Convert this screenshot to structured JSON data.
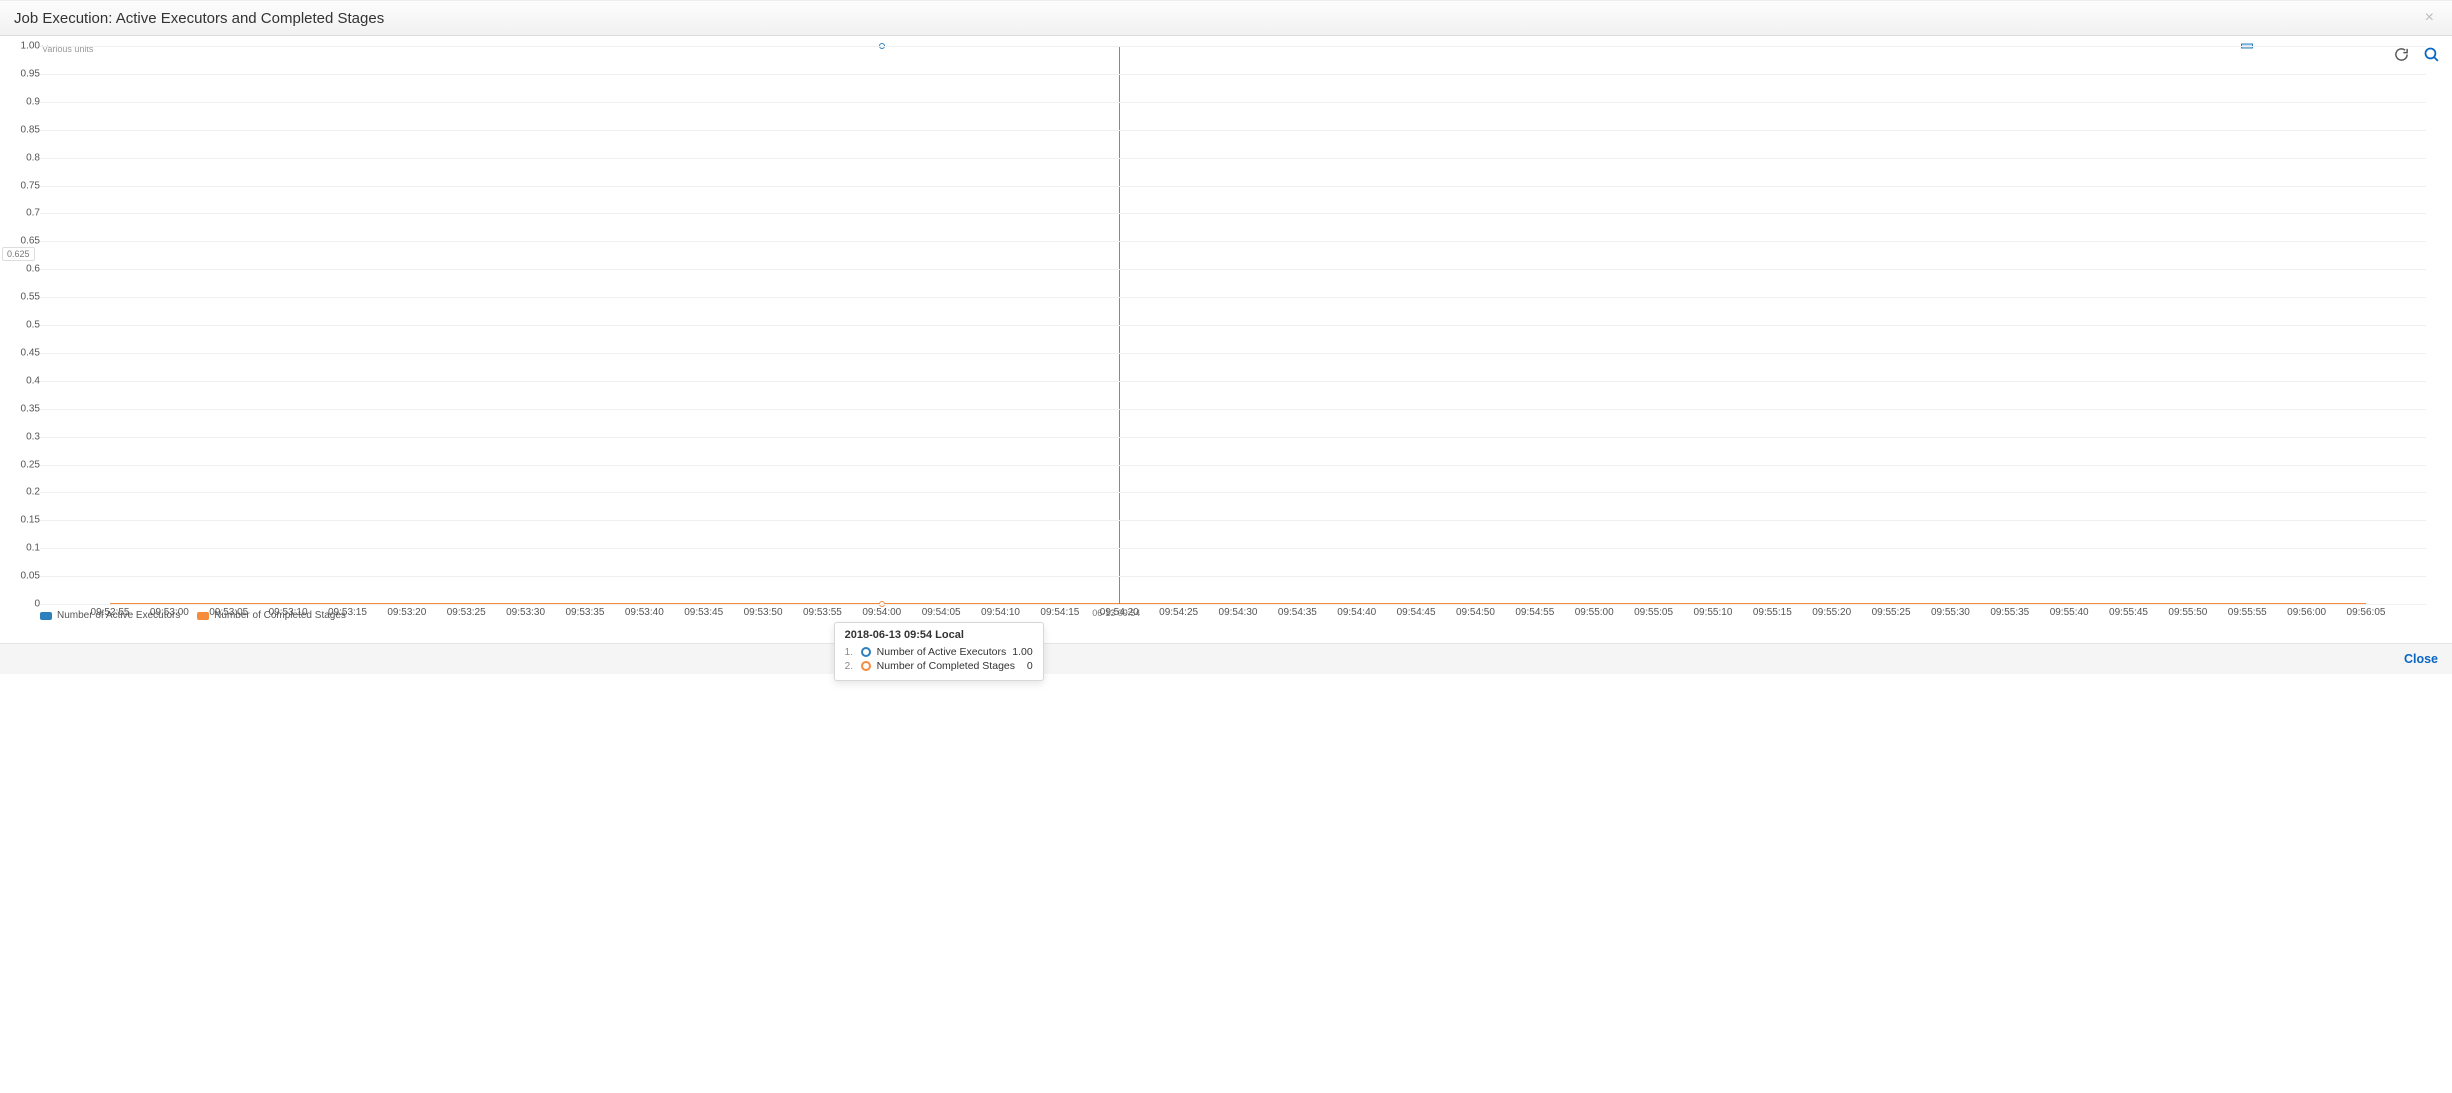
{
  "header": {
    "title": "Job Execution: Active Executors and Completed Stages"
  },
  "toolbar": {
    "refresh_icon_title": "Refresh",
    "zoom_icon_title": "Zoom"
  },
  "chart": {
    "unit_label": "Various units",
    "hover_y_value": "0.625",
    "crosshair_label": "06-13 09:54"
  },
  "legend": {
    "series_a": "Number of Active Executors",
    "series_b": "Number of Completed Stages"
  },
  "tooltip": {
    "title": "2018-06-13 09:54 Local",
    "row1_idx": "1.",
    "row1_label": "Number of Active Executors",
    "row1_value": "1.00",
    "row2_idx": "2.",
    "row2_label": "Number of Completed Stages",
    "row2_value": "0"
  },
  "footer": {
    "close_label": "Close"
  },
  "chart_data": {
    "type": "line",
    "title": "Job Execution: Active Executors and Completed Stages",
    "xlabel": "",
    "ylabel": "Various units",
    "ylim": [
      0,
      1.0
    ],
    "y_ticks": [
      0,
      0.05,
      0.1,
      0.15,
      0.2,
      0.25,
      0.3,
      0.35,
      0.4,
      0.45,
      0.5,
      0.55,
      0.6,
      0.65,
      0.7,
      0.75,
      0.8,
      0.85,
      0.9,
      0.95,
      1.0
    ],
    "x_ticks": [
      "09:52:55",
      "09:53:00",
      "09:53:05",
      "09:53:10",
      "09:53:15",
      "09:53:20",
      "09:53:25",
      "09:53:30",
      "09:53:35",
      "09:53:40",
      "09:53:45",
      "09:53:50",
      "09:53:55",
      "09:54:00",
      "09:54:05",
      "09:54:10",
      "09:54:15",
      "09:54:20",
      "09:54:25",
      "09:54:30",
      "09:54:35",
      "09:54:40",
      "09:54:45",
      "09:54:50",
      "09:54:55",
      "09:55:00",
      "09:55:05",
      "09:55:10",
      "09:55:15",
      "09:55:20",
      "09:55:25",
      "09:55:30",
      "09:55:35",
      "09:55:40",
      "09:55:45",
      "09:55:50",
      "09:55:55",
      "09:56:00",
      "09:56:05"
    ],
    "series": [
      {
        "name": "Number of Active Executors",
        "color": "#2d7fbd",
        "values": [
          1.0,
          1.0,
          1.0,
          1.0,
          1.0,
          1.0,
          1.0,
          1.0,
          1.0,
          1.0,
          1.0,
          1.0,
          1.0,
          1.0,
          1.0,
          1.0,
          1.0,
          1.0,
          1.0,
          1.0,
          1.0,
          1.0,
          1.0,
          1.0,
          1.0,
          1.0,
          1.0,
          1.0,
          1.0,
          1.0,
          1.0,
          1.0,
          1.0,
          1.0,
          1.0,
          1.0,
          1.0,
          1.0,
          1.0
        ]
      },
      {
        "name": "Number of Completed Stages",
        "color": "#f58b3c",
        "values": [
          0,
          0,
          0,
          0,
          0,
          0,
          0,
          0,
          0,
          0,
          0,
          0,
          0,
          0,
          0,
          0,
          0,
          0,
          0,
          0,
          0,
          0,
          0,
          0,
          0,
          0,
          0,
          0,
          0,
          0,
          0,
          0,
          0,
          0,
          0,
          0,
          0,
          0,
          0
        ]
      }
    ],
    "crosshair_x": "09:54:20",
    "hover_y": 0.625
  }
}
